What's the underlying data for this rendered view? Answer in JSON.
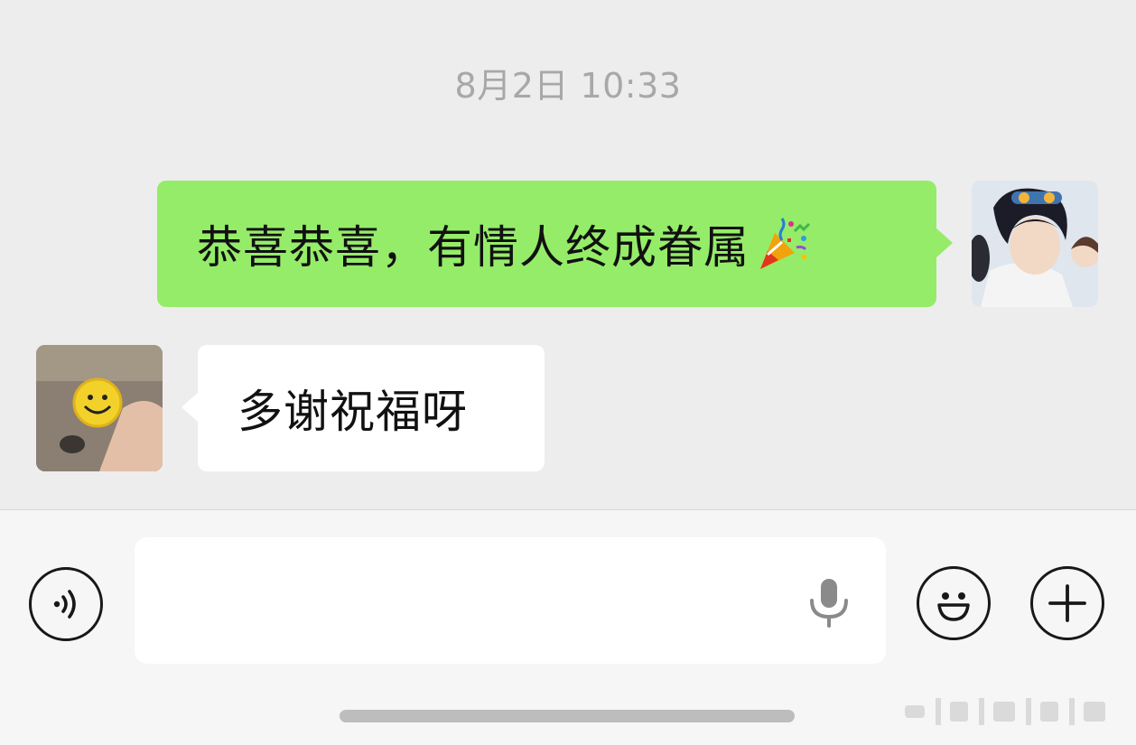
{
  "chat": {
    "timestamp": "8月2日 10:33",
    "messages": [
      {
        "sender": "me",
        "text": "恭喜恭喜，有情人终成眷属",
        "emoji": "party-popper"
      },
      {
        "sender": "other",
        "text": "多谢祝福呀"
      }
    ]
  },
  "input_bar": {
    "placeholder": "",
    "icons": [
      "voice-icon",
      "microphone-icon",
      "smiley-icon",
      "plus-icon"
    ]
  },
  "colors": {
    "background": "#ededed",
    "sent_bubble": "#95ec69",
    "received_bubble": "#ffffff",
    "input_bar": "#f6f6f6"
  }
}
